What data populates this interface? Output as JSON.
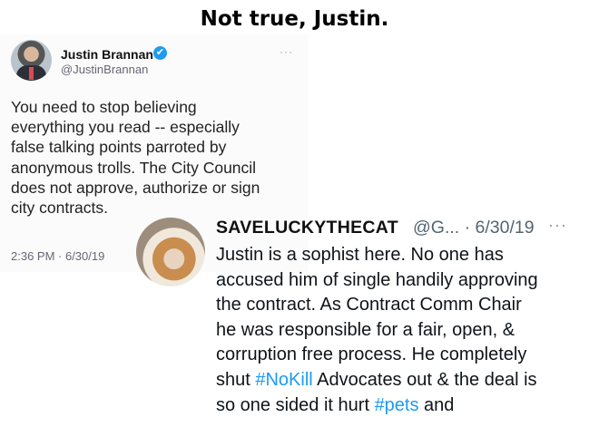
{
  "headline": "Not true, Justin.",
  "tweet1": {
    "author_name": "Justin Brannan",
    "verified_glyph": "✔",
    "handle": "@JustinBrannan",
    "more_glyph": "···",
    "lines": [
      "You need to stop believing",
      "everything you read -- especially",
      "false talking points parroted by",
      "anonymous trolls. The City Council",
      "does not approve, authorize or sign",
      "city contracts."
    ],
    "timestamp": "2:36 PM · 6/30/19",
    "icons": [
      "avatar-photo",
      "verified-badge-icon",
      "more-options-icon"
    ]
  },
  "tweet2": {
    "author_name": "SAVELUCKYTHECAT",
    "handle_date": "@G... · 6/30/19",
    "more_glyph": "···",
    "lines": [
      "Justin is a sophist here.  No one has",
      "accused him of single handily approving",
      "the contract.  As Contract Comm Chair",
      "he was responsible for a fair, open, &",
      "corruption free process.  He completely"
    ],
    "line6_before": "shut ",
    "hashtag_nokill": "#NoKill",
    "line6_after": " Advocates out & the deal is",
    "line7_before": "so one sided it hurt ",
    "hashtag_pets": "#pets",
    "line7_after": " and",
    "icons": [
      "cat-avatar-photo",
      "more-options-icon"
    ]
  },
  "colors": {
    "link": "#1d9bf0",
    "text": "#0f1419",
    "muted": "#536471",
    "verified": "#1d9bf0"
  }
}
